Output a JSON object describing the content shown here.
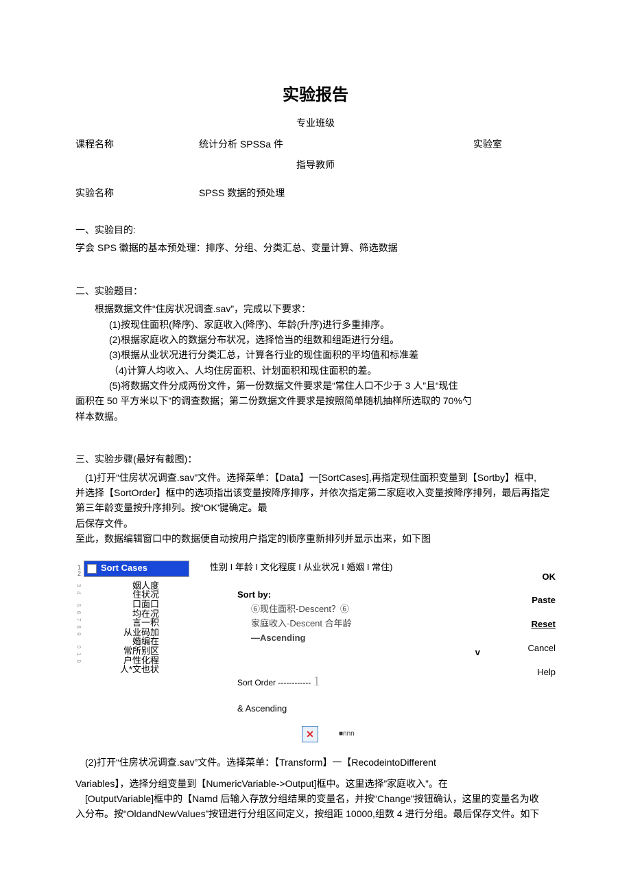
{
  "title": "实验报告",
  "center_line1": "专业班级",
  "center_line2": "指导教师",
  "row1": {
    "label": "课程名称",
    "value": "统计分析 SPSSa 件",
    "right": "实验室"
  },
  "row2": {
    "label": "实验名称",
    "value": "SPSS 数据的预处理"
  },
  "sec1": {
    "head": "一、实验目的:",
    "body": "学会 SPS 徽据的基本预处理：排序、分组、分类汇总、变量计算、筛选数据"
  },
  "sec2": {
    "head": "二、实验题目：",
    "intro": "根据数据文件“住房状况调查.sav”，完成以下要求：",
    "items": [
      "(1)按现住面积(降序)、家庭收入(降序)、年龄(升序)进行多重排序。",
      "(2)根据家庭收入的数据分布状况，选择恰当的组数和组距进行分组。",
      "(3)根据从业状况进行分类汇总，计算各行业的现住面积的平均值和标准差",
      "（4)计算人均收入、人均住房面积、计划面积和现住面积的差。"
    ],
    "item5a": "(5)将数据文件分成两份文件，第一份数据文件要求是“常住人口不少于 3 人”且“现住",
    "item5b": "面积在 50 平方米以下”的调查数据；第二份数据文件要求是按照简单随机抽样所选取的 70%勺",
    "item5c": "样本数据。"
  },
  "sec3": {
    "head": "三、实验步骤(最好有截图)：",
    "p1a": "(1)打开“住房状况调查.sav”文件。选择菜单：【Data】一[SortCases],再指定现住面积变量到【Sortby】框中,",
    "p1b": "并选择【SortOrder】框中的选项指出该变量按降序排序，并依次指定第二家庭收入变量按降序排列，最后再指定",
    "p1c": "第三年龄变量按升序排列。按“OK'键确定。最",
    "p1d": "后保存文件。",
    "p1e": "至此，数据编辑窗口中的数据便自动按用户指定的顺序重新排列并显示出来，如下图"
  },
  "dialog": {
    "bar": "Sort Cases",
    "nums": [
      "1",
      "2"
    ],
    "side": "34 56789 010",
    "vars": [
      "姻人度",
      "住状况",
      "口面口",
      "均在况",
      "言一积",
      "从业码加",
      "婚编在",
      "常所别区",
      "户性化程",
      "人*文也状"
    ],
    "topvars": "性别 I 年龄 I 文化程度 I 从业状况 I 婚姻 I 常住)",
    "sortby_label": "Sort by:",
    "sort1": "⑥现住面积-Descent？⑥",
    "sort2": "家庭收入-Descent 合年龄",
    "sort3": "—Ascending",
    "v": "v",
    "order_label": "Sort Order ------------",
    "order_bar": "1",
    "amp": "& Ascending",
    "buttons": {
      "ok": "OK",
      "paste": "Paste",
      "reset": "Reset",
      "cancel": "Cancel",
      "help": "Help"
    },
    "nnn": "■nnn"
  },
  "sec3p2": {
    "a": "(2)打开“住房状况调查.sav”文件。选择菜单：【Transform】一【RecodeintoDifferent",
    "b": "Variables】，选择分组变量到【NumericVariable->Output]框中。这里选择”家庭收入”。在",
    "c": "[OutputVariable]框中的【Namd 后输入存放分组结果的变量名，并按“Change”按钮确认，这里的变量名为收",
    "d": "入分布。按“OldandNewValues”按钮进行分组区间定义，按组距 10000,组数 4 进行分组。最后保存文件。如下"
  }
}
